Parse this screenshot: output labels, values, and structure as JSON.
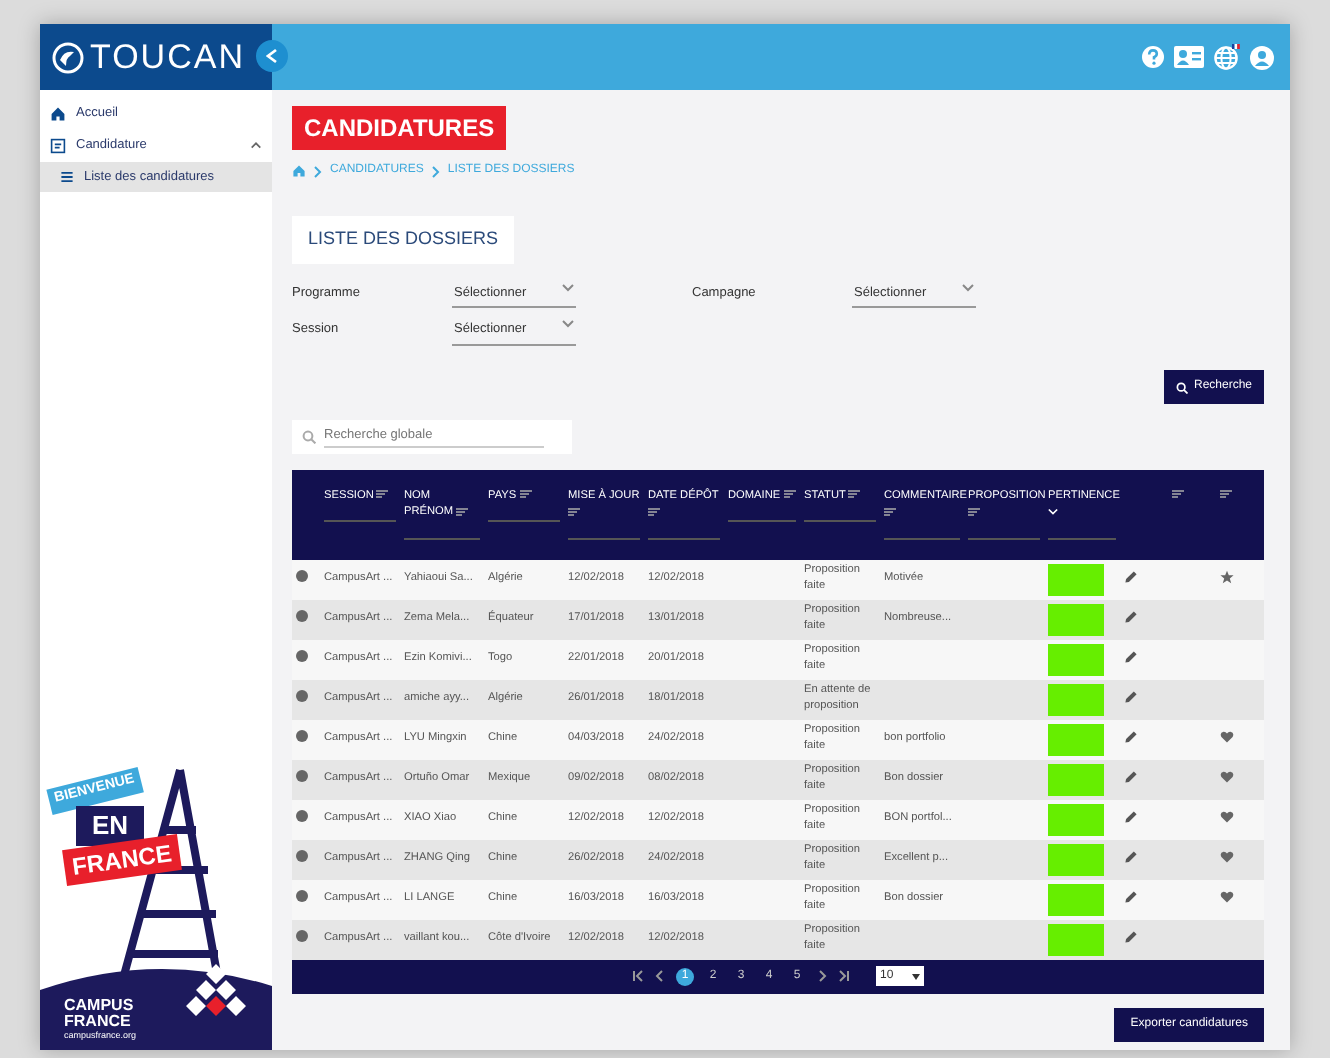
{
  "app": {
    "logo": "TOUCAN"
  },
  "sidebar": {
    "items": [
      {
        "label": "Accueil",
        "selected": false
      },
      {
        "label": "Candidature",
        "selected": false,
        "expanded": true,
        "children": [
          {
            "label": "Liste des candidatures",
            "selected": true
          }
        ]
      }
    ],
    "poster": {
      "tag": "BIENVENUE",
      "line1": "EN",
      "line2": "FRANCE",
      "brand1": "CAMPUS",
      "brand2": "FRANCE",
      "url": "campusfrance.org"
    }
  },
  "page": {
    "title": "CANDIDATURES",
    "breadcrumb": [
      "CANDIDATURES",
      "LISTE DES DOSSIERS"
    ],
    "section": "LISTE DES DOSSIERS"
  },
  "filters": [
    {
      "label": "Programme",
      "value": "Sélectionner"
    },
    {
      "label": "Campagne",
      "value": "Sélectionner"
    },
    {
      "label": "Session",
      "value": "Sélectionner"
    }
  ],
  "search_button": "Recherche",
  "global_search": {
    "placeholder": "Recherche globale"
  },
  "table": {
    "columns": [
      [
        "SESSION"
      ],
      [
        "NOM",
        "PRÉNOM"
      ],
      [
        "PAYS"
      ],
      [
        "MISE À JOUR"
      ],
      [
        "DATE DÉPÔT"
      ],
      [
        "DOMAINE"
      ],
      [
        "STATUT"
      ],
      [
        "COMMENTAIRE"
      ],
      [
        "PROPOSITION"
      ],
      [
        "PERTINENCE"
      ]
    ],
    "rows": [
      {
        "session": "CampusArt ...",
        "name": "Yahiaoui Sa...",
        "country": "Algérie",
        "updated": "12/02/2018",
        "filed": "12/02/2018",
        "status": "Proposition faite",
        "comment": "Motivée",
        "starred": true,
        "favorite": false
      },
      {
        "session": "CampusArt ...",
        "name": "Zema Mela...",
        "country": "Équateur",
        "updated": "17/01/2018",
        "filed": "13/01/2018",
        "status": "Proposition faite",
        "comment": "Nombreuse...",
        "starred": false,
        "favorite": false
      },
      {
        "session": "CampusArt ...",
        "name": "Ezin Komivi...",
        "country": "Togo",
        "updated": "22/01/2018",
        "filed": "20/01/2018",
        "status": "Proposition faite",
        "comment": "",
        "starred": false,
        "favorite": false
      },
      {
        "session": "CampusArt ...",
        "name": "amiche ayy...",
        "country": "Algérie",
        "updated": "26/01/2018",
        "filed": "18/01/2018",
        "status": "En attente de proposition",
        "comment": "",
        "starred": false,
        "favorite": false
      },
      {
        "session": "CampusArt ...",
        "name": "LYU Mingxin",
        "country": "Chine",
        "updated": "04/03/2018",
        "filed": "24/02/2018",
        "status": "Proposition faite",
        "comment": "bon portfolio",
        "starred": false,
        "favorite": true
      },
      {
        "session": "CampusArt ...",
        "name": "Ortuño Omar",
        "country": "Mexique",
        "updated": "09/02/2018",
        "filed": "08/02/2018",
        "status": "Proposition faite",
        "comment": "Bon dossier",
        "starred": false,
        "favorite": true
      },
      {
        "session": "CampusArt ...",
        "name": "XIAO Xiao",
        "country": "Chine",
        "updated": "12/02/2018",
        "filed": "12/02/2018",
        "status": "Proposition faite",
        "comment": "BON portfol...",
        "starred": false,
        "favorite": true
      },
      {
        "session": "CampusArt ...",
        "name": "ZHANG Qing",
        "country": "Chine",
        "updated": "26/02/2018",
        "filed": "24/02/2018",
        "status": "Proposition faite",
        "comment": "Excellent p...",
        "starred": false,
        "favorite": true
      },
      {
        "session": "CampusArt ...",
        "name": "LI LANGE",
        "country": "Chine",
        "updated": "16/03/2018",
        "filed": "16/03/2018",
        "status": "Proposition faite",
        "comment": "Bon dossier",
        "starred": false,
        "favorite": true
      },
      {
        "session": "CampusArt ...",
        "name": "vaillant kou...",
        "country": "Côte d'Ivoire",
        "updated": "12/02/2018",
        "filed": "12/02/2018",
        "status": "Proposition faite",
        "comment": "",
        "starred": false,
        "favorite": false
      }
    ]
  },
  "pagination": {
    "pages": [
      {
        "label": "1",
        "selected": true
      },
      {
        "label": "2",
        "selected": false
      },
      {
        "label": "3",
        "selected": false
      },
      {
        "label": "4",
        "selected": false
      },
      {
        "label": "5",
        "selected": false
      }
    ],
    "page_size": "10"
  },
  "export_button": "Exporter candidatures"
}
